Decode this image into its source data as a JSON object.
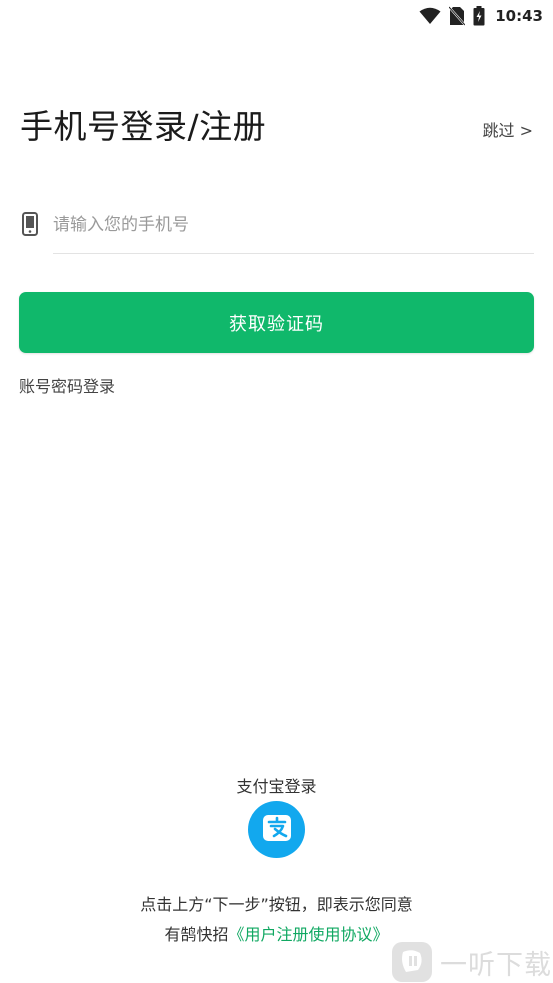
{
  "status_bar": {
    "time": "10:43",
    "icons": [
      "wifi-icon",
      "no-sim-icon",
      "battery-charging-icon"
    ]
  },
  "header": {
    "title": "手机号登录/注册",
    "skip_label": "跳过 >"
  },
  "phone_field": {
    "icon": "phone-icon",
    "placeholder": "请输入您的手机号",
    "value": ""
  },
  "primary_button": {
    "label": "获取验证码"
  },
  "alt_login": {
    "password_login_label": "账号密码登录"
  },
  "alipay": {
    "label": "支付宝登录",
    "icon": "alipay-icon",
    "color": "#12a8ee"
  },
  "agreement": {
    "line1": "点击上方“下一步”按钮，即表示您同意",
    "line2_prefix": "有鹄快招",
    "link_text": "《用户注册使用协议》"
  },
  "watermark": {
    "text": "一听下载"
  },
  "colors": {
    "accent": "#10b86b",
    "link": "#10a862",
    "alipay": "#12a8ee"
  }
}
